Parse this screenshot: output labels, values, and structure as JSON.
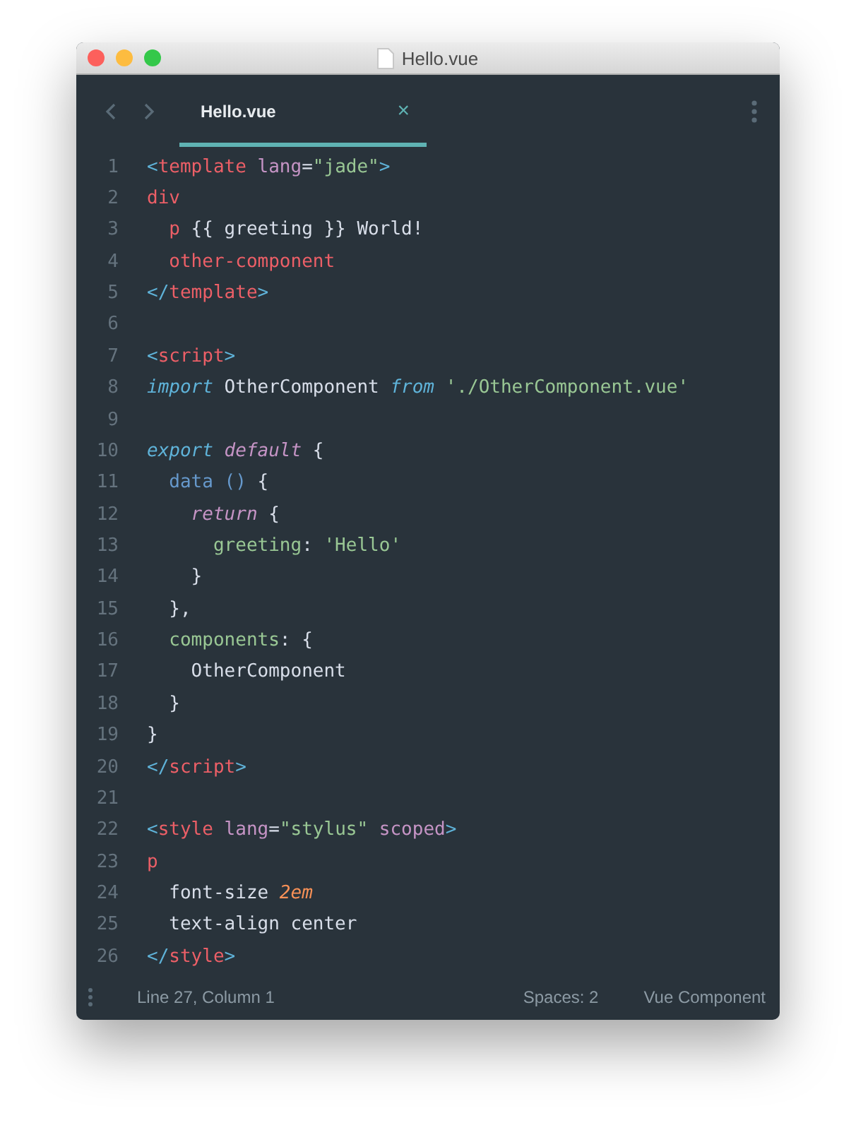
{
  "window": {
    "title": "Hello.vue"
  },
  "tabs": [
    {
      "label": "Hello.vue",
      "selected": true,
      "close": "×"
    }
  ],
  "editor": {
    "lines": [
      {
        "number": "1",
        "tokens": [
          {
            "kind": "punct",
            "text": "<"
          },
          {
            "kind": "tag",
            "text": "template"
          },
          {
            "kind": "attr",
            "text": " lang"
          },
          {
            "kind": "plain",
            "text": "="
          },
          {
            "kind": "string",
            "text": "\"jade\""
          },
          {
            "kind": "punct",
            "text": ">"
          }
        ]
      },
      {
        "number": "2",
        "tokens": [
          {
            "kind": "tag",
            "text": "div"
          }
        ]
      },
      {
        "number": "3",
        "tokens": [
          {
            "kind": "tag",
            "text": "  p"
          },
          {
            "kind": "plain",
            "text": " {{ greeting }} World!"
          }
        ]
      },
      {
        "number": "4",
        "tokens": [
          {
            "kind": "tag",
            "text": "  other-component"
          }
        ]
      },
      {
        "number": "5",
        "tokens": [
          {
            "kind": "punct",
            "text": "</"
          },
          {
            "kind": "tag",
            "text": "template"
          },
          {
            "kind": "punct",
            "text": ">"
          }
        ]
      },
      {
        "number": "6"
      },
      {
        "number": "7",
        "tokens": [
          {
            "kind": "punct",
            "text": "<"
          },
          {
            "kind": "tag",
            "text": "script"
          },
          {
            "kind": "punct",
            "text": ">"
          }
        ]
      },
      {
        "number": "8",
        "tokens": [
          {
            "kind": "keyword",
            "text": "import"
          },
          {
            "kind": "plain",
            "text": " OtherComponent "
          },
          {
            "kind": "keyword",
            "text": "from"
          },
          {
            "kind": "string",
            "text": " './OtherComponent.vue'"
          }
        ]
      },
      {
        "number": "9"
      },
      {
        "number": "10",
        "tokens": [
          {
            "kind": "keyword",
            "text": "export"
          },
          {
            "kind": "keyword2",
            "text": " default"
          },
          {
            "kind": "plain",
            "text": " {"
          }
        ]
      },
      {
        "number": "11",
        "tokens": [
          {
            "kind": "func",
            "text": "  data"
          },
          {
            "kind": "func",
            "text": " ()"
          },
          {
            "kind": "plain",
            "text": " {"
          }
        ]
      },
      {
        "number": "12",
        "tokens": [
          {
            "kind": "keyword2",
            "text": "    return"
          },
          {
            "kind": "plain",
            "text": " {"
          }
        ]
      },
      {
        "number": "13",
        "tokens": [
          {
            "kind": "prop",
            "text": "      greeting"
          },
          {
            "kind": "plain",
            "text": ": "
          },
          {
            "kind": "string",
            "text": "'Hello'"
          }
        ]
      },
      {
        "number": "14",
        "tokens": [
          {
            "kind": "plain",
            "text": "    }"
          }
        ]
      },
      {
        "number": "15",
        "tokens": [
          {
            "kind": "plain",
            "text": "  },"
          }
        ]
      },
      {
        "number": "16",
        "tokens": [
          {
            "kind": "prop",
            "text": "  components"
          },
          {
            "kind": "plain",
            "text": ": {"
          }
        ]
      },
      {
        "number": "17",
        "tokens": [
          {
            "kind": "plain",
            "text": "    OtherComponent"
          }
        ]
      },
      {
        "number": "18",
        "tokens": [
          {
            "kind": "plain",
            "text": "  }"
          }
        ]
      },
      {
        "number": "19",
        "tokens": [
          {
            "kind": "plain",
            "text": "}"
          }
        ]
      },
      {
        "number": "20",
        "tokens": [
          {
            "kind": "punct",
            "text": "</"
          },
          {
            "kind": "tag",
            "text": "script"
          },
          {
            "kind": "punct",
            "text": ">"
          }
        ]
      },
      {
        "number": "21"
      },
      {
        "number": "22",
        "tokens": [
          {
            "kind": "punct",
            "text": "<"
          },
          {
            "kind": "tag",
            "text": "style"
          },
          {
            "kind": "attr",
            "text": " lang"
          },
          {
            "kind": "plain",
            "text": "="
          },
          {
            "kind": "string",
            "text": "\"stylus\""
          },
          {
            "kind": "attr",
            "text": " scoped"
          },
          {
            "kind": "punct",
            "text": ">"
          }
        ]
      },
      {
        "number": "23",
        "tokens": [
          {
            "kind": "tag",
            "text": "p"
          }
        ]
      },
      {
        "number": "24",
        "tokens": [
          {
            "kind": "plain",
            "text": "  font-size "
          },
          {
            "kind": "number",
            "text": "2em"
          }
        ]
      },
      {
        "number": "25",
        "tokens": [
          {
            "kind": "plain",
            "text": "  text-align center"
          }
        ]
      },
      {
        "number": "26",
        "tokens": [
          {
            "kind": "punct",
            "text": "</"
          },
          {
            "kind": "tag",
            "text": "style"
          },
          {
            "kind": "punct",
            "text": ">"
          }
        ]
      }
    ]
  },
  "status_bar": {
    "position": "Line 27, Column 1",
    "indentation": "Spaces: 2",
    "syntax": "Vue Component"
  }
}
